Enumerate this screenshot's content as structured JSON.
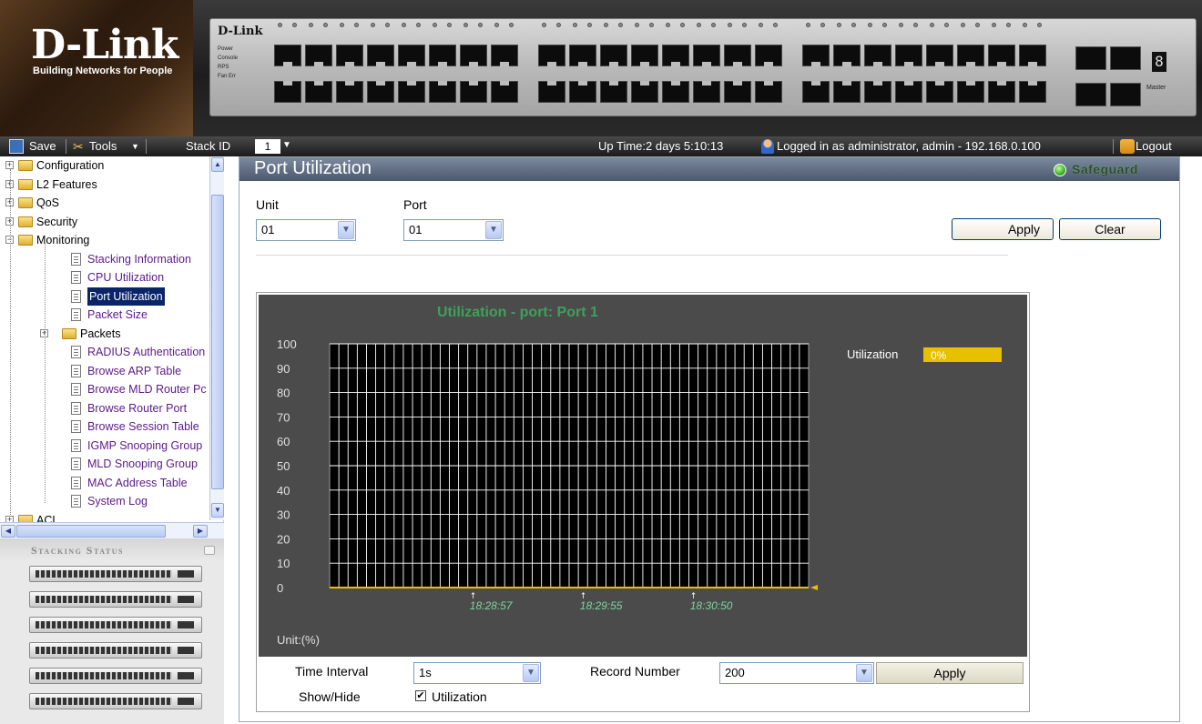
{
  "banner": {
    "logo": "D-Link",
    "tagline": "Building Networks for People",
    "device_brand": "D-Link",
    "device_leds": [
      "Power",
      "Console",
      "RPS",
      "Fan Err"
    ],
    "master_label": "Master"
  },
  "toolbar": {
    "save_label": "Save",
    "tools_label": "Tools",
    "stack_id_label": "Stack ID",
    "stack_id_value": "1",
    "uptime_text": "Up Time:2 days 5:10:13",
    "login_text": "Logged in as administrator, admin - 192.168.0.100",
    "logout_label": "Logout"
  },
  "tree": {
    "items": [
      {
        "label": "Configuration",
        "level": 0,
        "type": "folder",
        "expander": "+"
      },
      {
        "label": "L2 Features",
        "level": 0,
        "type": "folder",
        "expander": "+"
      },
      {
        "label": "QoS",
        "level": 0,
        "type": "folder",
        "expander": "+"
      },
      {
        "label": "Security",
        "level": 0,
        "type": "folder",
        "expander": "+"
      },
      {
        "label": "Monitoring",
        "level": 0,
        "type": "folder",
        "expander": "-"
      },
      {
        "label": "Stacking Information",
        "level": 1,
        "type": "doc"
      },
      {
        "label": "CPU Utilization",
        "level": 1,
        "type": "doc"
      },
      {
        "label": "Port Utilization",
        "level": 1,
        "type": "doc",
        "selected": true
      },
      {
        "label": "Packet Size",
        "level": 1,
        "type": "doc"
      },
      {
        "label": "Packets",
        "level": 1,
        "type": "folder",
        "expander": "+"
      },
      {
        "label": "RADIUS Authentication",
        "level": 1,
        "type": "doc"
      },
      {
        "label": "Browse ARP Table",
        "level": 1,
        "type": "doc"
      },
      {
        "label": "Browse MLD Router Pc",
        "level": 1,
        "type": "doc"
      },
      {
        "label": "Browse Router Port",
        "level": 1,
        "type": "doc"
      },
      {
        "label": "Browse Session Table",
        "level": 1,
        "type": "doc"
      },
      {
        "label": "IGMP Snooping Group",
        "level": 1,
        "type": "doc"
      },
      {
        "label": "MLD Snooping Group",
        "level": 1,
        "type": "doc"
      },
      {
        "label": "MAC Address Table",
        "level": 1,
        "type": "doc"
      },
      {
        "label": "System Log",
        "level": 1,
        "type": "doc"
      },
      {
        "label": "ACL",
        "level": 0,
        "type": "folder",
        "expander": "+"
      }
    ]
  },
  "stacking_status": {
    "title": "Stacking Status",
    "unit_count": 6
  },
  "main": {
    "title": "Port Utilization",
    "safeguard_label": "Safeguard",
    "unit_label": "Unit",
    "unit_value": "01",
    "port_label": "Port",
    "port_value": "01",
    "apply_label": "Apply",
    "clear_label": "Clear"
  },
  "chart_controls": {
    "time_interval_label": "Time Interval",
    "time_interval_value": "1s",
    "record_number_label": "Record Number",
    "record_number_value": "200",
    "apply_label": "Apply",
    "show_hide_label": "Show/Hide",
    "utilization_checkbox_label": "Utilization",
    "utilization_checked": true
  },
  "chart_data": {
    "type": "line",
    "title": "Utilization - port: Port 1",
    "ylabel": "Unit:(%)",
    "ylim": [
      0,
      100
    ],
    "yticks": [
      100,
      90,
      80,
      70,
      60,
      50,
      40,
      30,
      20,
      10,
      0
    ],
    "xtick_labels": [
      "18:28:57",
      "18:29:55",
      "18:30:50"
    ],
    "series": [
      {
        "name": "Utilization",
        "values": [
          0
        ],
        "current_value_label": "0%",
        "color": "#e8c000"
      }
    ],
    "grid": true,
    "legend_placement": "right",
    "colors": {
      "background": "#4b4b4b",
      "plot": "#000000",
      "grid": "#ffffff",
      "title": "#3fa05a",
      "axis_text": "#e0e0e0",
      "time_text": "#7fd6a0"
    }
  }
}
